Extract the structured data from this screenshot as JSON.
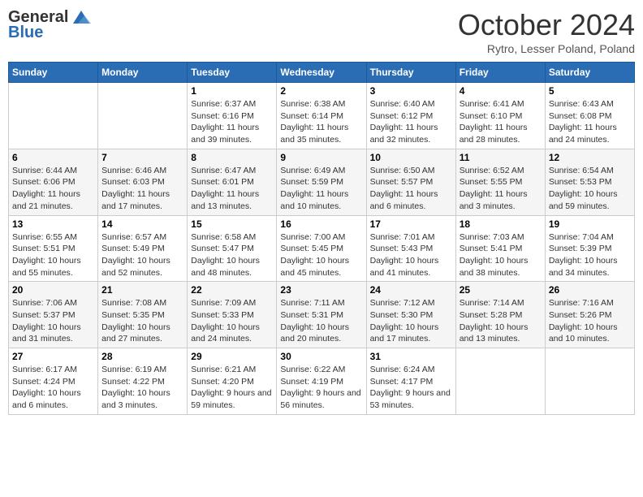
{
  "logo": {
    "general": "General",
    "blue": "Blue"
  },
  "title": "October 2024",
  "location": "Rytro, Lesser Poland, Poland",
  "days_of_week": [
    "Sunday",
    "Monday",
    "Tuesday",
    "Wednesday",
    "Thursday",
    "Friday",
    "Saturday"
  ],
  "weeks": [
    [
      {
        "day": "",
        "sunrise": "",
        "sunset": "",
        "daylight": ""
      },
      {
        "day": "",
        "sunrise": "",
        "sunset": "",
        "daylight": ""
      },
      {
        "day": "1",
        "sunrise": "Sunrise: 6:37 AM",
        "sunset": "Sunset: 6:16 PM",
        "daylight": "Daylight: 11 hours and 39 minutes."
      },
      {
        "day": "2",
        "sunrise": "Sunrise: 6:38 AM",
        "sunset": "Sunset: 6:14 PM",
        "daylight": "Daylight: 11 hours and 35 minutes."
      },
      {
        "day": "3",
        "sunrise": "Sunrise: 6:40 AM",
        "sunset": "Sunset: 6:12 PM",
        "daylight": "Daylight: 11 hours and 32 minutes."
      },
      {
        "day": "4",
        "sunrise": "Sunrise: 6:41 AM",
        "sunset": "Sunset: 6:10 PM",
        "daylight": "Daylight: 11 hours and 28 minutes."
      },
      {
        "day": "5",
        "sunrise": "Sunrise: 6:43 AM",
        "sunset": "Sunset: 6:08 PM",
        "daylight": "Daylight: 11 hours and 24 minutes."
      }
    ],
    [
      {
        "day": "6",
        "sunrise": "Sunrise: 6:44 AM",
        "sunset": "Sunset: 6:06 PM",
        "daylight": "Daylight: 11 hours and 21 minutes."
      },
      {
        "day": "7",
        "sunrise": "Sunrise: 6:46 AM",
        "sunset": "Sunset: 6:03 PM",
        "daylight": "Daylight: 11 hours and 17 minutes."
      },
      {
        "day": "8",
        "sunrise": "Sunrise: 6:47 AM",
        "sunset": "Sunset: 6:01 PM",
        "daylight": "Daylight: 11 hours and 13 minutes."
      },
      {
        "day": "9",
        "sunrise": "Sunrise: 6:49 AM",
        "sunset": "Sunset: 5:59 PM",
        "daylight": "Daylight: 11 hours and 10 minutes."
      },
      {
        "day": "10",
        "sunrise": "Sunrise: 6:50 AM",
        "sunset": "Sunset: 5:57 PM",
        "daylight": "Daylight: 11 hours and 6 minutes."
      },
      {
        "day": "11",
        "sunrise": "Sunrise: 6:52 AM",
        "sunset": "Sunset: 5:55 PM",
        "daylight": "Daylight: 11 hours and 3 minutes."
      },
      {
        "day": "12",
        "sunrise": "Sunrise: 6:54 AM",
        "sunset": "Sunset: 5:53 PM",
        "daylight": "Daylight: 10 hours and 59 minutes."
      }
    ],
    [
      {
        "day": "13",
        "sunrise": "Sunrise: 6:55 AM",
        "sunset": "Sunset: 5:51 PM",
        "daylight": "Daylight: 10 hours and 55 minutes."
      },
      {
        "day": "14",
        "sunrise": "Sunrise: 6:57 AM",
        "sunset": "Sunset: 5:49 PM",
        "daylight": "Daylight: 10 hours and 52 minutes."
      },
      {
        "day": "15",
        "sunrise": "Sunrise: 6:58 AM",
        "sunset": "Sunset: 5:47 PM",
        "daylight": "Daylight: 10 hours and 48 minutes."
      },
      {
        "day": "16",
        "sunrise": "Sunrise: 7:00 AM",
        "sunset": "Sunset: 5:45 PM",
        "daylight": "Daylight: 10 hours and 45 minutes."
      },
      {
        "day": "17",
        "sunrise": "Sunrise: 7:01 AM",
        "sunset": "Sunset: 5:43 PM",
        "daylight": "Daylight: 10 hours and 41 minutes."
      },
      {
        "day": "18",
        "sunrise": "Sunrise: 7:03 AM",
        "sunset": "Sunset: 5:41 PM",
        "daylight": "Daylight: 10 hours and 38 minutes."
      },
      {
        "day": "19",
        "sunrise": "Sunrise: 7:04 AM",
        "sunset": "Sunset: 5:39 PM",
        "daylight": "Daylight: 10 hours and 34 minutes."
      }
    ],
    [
      {
        "day": "20",
        "sunrise": "Sunrise: 7:06 AM",
        "sunset": "Sunset: 5:37 PM",
        "daylight": "Daylight: 10 hours and 31 minutes."
      },
      {
        "day": "21",
        "sunrise": "Sunrise: 7:08 AM",
        "sunset": "Sunset: 5:35 PM",
        "daylight": "Daylight: 10 hours and 27 minutes."
      },
      {
        "day": "22",
        "sunrise": "Sunrise: 7:09 AM",
        "sunset": "Sunset: 5:33 PM",
        "daylight": "Daylight: 10 hours and 24 minutes."
      },
      {
        "day": "23",
        "sunrise": "Sunrise: 7:11 AM",
        "sunset": "Sunset: 5:31 PM",
        "daylight": "Daylight: 10 hours and 20 minutes."
      },
      {
        "day": "24",
        "sunrise": "Sunrise: 7:12 AM",
        "sunset": "Sunset: 5:30 PM",
        "daylight": "Daylight: 10 hours and 17 minutes."
      },
      {
        "day": "25",
        "sunrise": "Sunrise: 7:14 AM",
        "sunset": "Sunset: 5:28 PM",
        "daylight": "Daylight: 10 hours and 13 minutes."
      },
      {
        "day": "26",
        "sunrise": "Sunrise: 7:16 AM",
        "sunset": "Sunset: 5:26 PM",
        "daylight": "Daylight: 10 hours and 10 minutes."
      }
    ],
    [
      {
        "day": "27",
        "sunrise": "Sunrise: 6:17 AM",
        "sunset": "Sunset: 4:24 PM",
        "daylight": "Daylight: 10 hours and 6 minutes."
      },
      {
        "day": "28",
        "sunrise": "Sunrise: 6:19 AM",
        "sunset": "Sunset: 4:22 PM",
        "daylight": "Daylight: 10 hours and 3 minutes."
      },
      {
        "day": "29",
        "sunrise": "Sunrise: 6:21 AM",
        "sunset": "Sunset: 4:20 PM",
        "daylight": "Daylight: 9 hours and 59 minutes."
      },
      {
        "day": "30",
        "sunrise": "Sunrise: 6:22 AM",
        "sunset": "Sunset: 4:19 PM",
        "daylight": "Daylight: 9 hours and 56 minutes."
      },
      {
        "day": "31",
        "sunrise": "Sunrise: 6:24 AM",
        "sunset": "Sunset: 4:17 PM",
        "daylight": "Daylight: 9 hours and 53 minutes."
      },
      {
        "day": "",
        "sunrise": "",
        "sunset": "",
        "daylight": ""
      },
      {
        "day": "",
        "sunrise": "",
        "sunset": "",
        "daylight": ""
      }
    ]
  ]
}
